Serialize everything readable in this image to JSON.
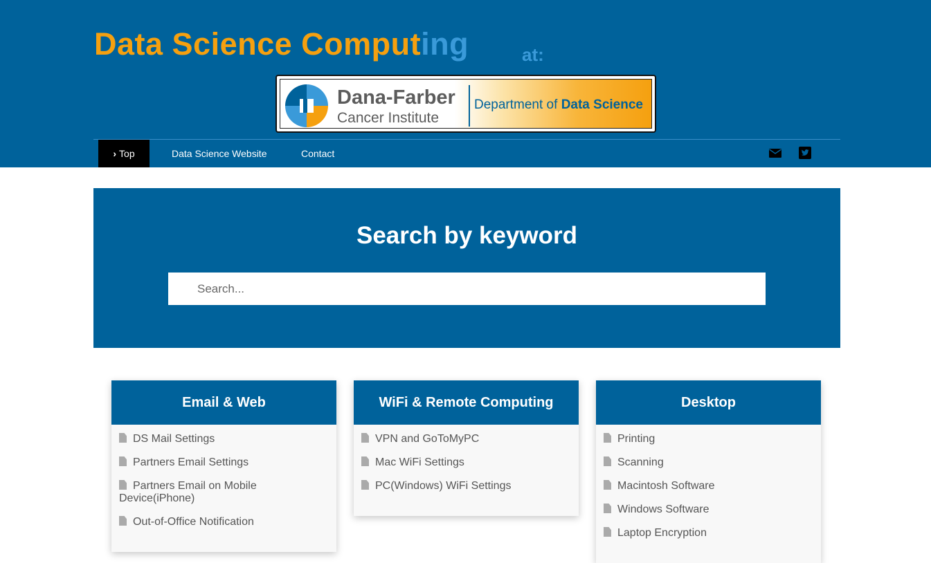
{
  "header": {
    "title_main": "Data Science Comput",
    "title_tail": "ing",
    "title_at": "at:",
    "logo": {
      "name": "Dana-Farber",
      "sub": "Cancer Institute",
      "dept_prefix": "Department of",
      "dept_bold": "Data Science"
    }
  },
  "nav": {
    "items": [
      {
        "label": "Top",
        "active": true
      },
      {
        "label": "Data Science Website",
        "active": false
      },
      {
        "label": "Contact",
        "active": false
      }
    ],
    "icons": [
      "envelope-icon",
      "twitter-icon"
    ]
  },
  "search": {
    "heading": "Search by keyword",
    "placeholder": "Search...",
    "value": ""
  },
  "cards": [
    {
      "title": "Email & Web",
      "items": [
        "DS Mail Settings",
        "Partners Email Settings",
        "Partners Email on Mobile Device(iPhone)",
        "Out-of-Office Notification"
      ]
    },
    {
      "title": "WiFi & Remote Computing",
      "items": [
        "VPN and GoToMyPC",
        "Mac WiFi Settings",
        "PC(Windows) WiFi Settings"
      ]
    },
    {
      "title": "Desktop",
      "items": [
        "Printing",
        "Scanning",
        "Macintosh Software",
        "Windows Software",
        "Laptop Encryption"
      ]
    }
  ],
  "colors": {
    "brand_blue": "#00629b",
    "title_orange": "#f5a00f",
    "accent_light_blue": "#3a9ad9",
    "active_nav": "#000000"
  }
}
